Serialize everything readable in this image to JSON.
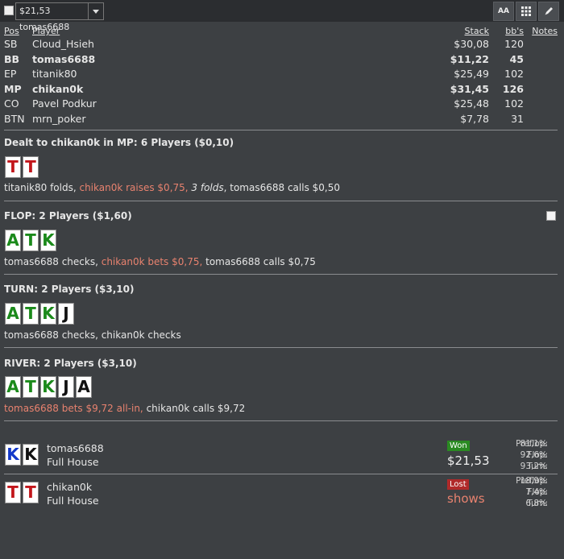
{
  "toolbar": {
    "hand_selector_value": "$21,53 tomas6688",
    "font_button_label": "AA"
  },
  "table_header": {
    "pos": "Pos",
    "player": "Player",
    "stack": "Stack",
    "bbs": "bb's",
    "notes": "Notes"
  },
  "players": [
    {
      "pos": "SB",
      "name": "Cloud_Hsieh",
      "stack": "$30,08",
      "bbs": "120",
      "bold": false
    },
    {
      "pos": "BB",
      "name": "tomas6688",
      "stack": "$11,22",
      "bbs": "45",
      "bold": true
    },
    {
      "pos": "EP",
      "name": "titanik80",
      "stack": "$25,49",
      "bbs": "102",
      "bold": false
    },
    {
      "pos": "MP",
      "name": "chikan0k",
      "stack": "$31,45",
      "bbs": "126",
      "bold": true
    },
    {
      "pos": "CO",
      "name": "Pavel Podkur",
      "stack": "$25,48",
      "bbs": "102",
      "bold": false
    },
    {
      "pos": "BTN",
      "name": "mrn_poker",
      "stack": "$7,78",
      "bbs": "31",
      "bold": false
    }
  ],
  "preflop": {
    "title": "Dealt to chikan0k in MP: 6 Players ($0,10)",
    "cards": [
      "T",
      "T"
    ],
    "action_parts": [
      "titanik80 folds, ",
      "chikan0k raises $0,75, ",
      "3 folds",
      ", tomas6688 calls $0,50"
    ]
  },
  "flop": {
    "title": "FLOP: 2 Players ($1,60)",
    "cards": [
      "A",
      "T",
      "K"
    ],
    "action_parts": [
      "tomas6688 checks, ",
      "chikan0k bets $0,75, ",
      "tomas6688 calls $0,75"
    ]
  },
  "turn": {
    "title": "TURN: 2 Players ($3,10)",
    "cards": [
      "A",
      "T",
      "K",
      "J"
    ],
    "action": "tomas6688 checks, chikan0k checks"
  },
  "river": {
    "title": "RIVER: 2 Players ($3,10)",
    "cards": [
      "A",
      "T",
      "K",
      "J",
      "A"
    ],
    "action_parts": [
      "tomas6688 bets $9,72 all-in, ",
      "chikan0k calls $9,72"
    ]
  },
  "showdown": [
    {
      "cards": [
        "K",
        "K"
      ],
      "name": "tomas6688",
      "hand": "Full House",
      "result": "Won",
      "amount": "$21,53",
      "equity": [
        {
          "street": "Preflop:",
          "value": "81,1%"
        },
        {
          "street": "Flop:",
          "value": "92,6%"
        },
        {
          "street": "Turn:",
          "value": "93,2%"
        }
      ]
    },
    {
      "cards": [
        "T",
        "T"
      ],
      "name": "chikan0k",
      "hand": "Full House",
      "result": "Lost",
      "amount": "shows",
      "equity": [
        {
          "street": "Preflop:",
          "value": "18,9%"
        },
        {
          "street": "Flop:",
          "value": "7,4%"
        },
        {
          "street": "Turn:",
          "value": "6,8%"
        }
      ]
    }
  ],
  "colors": {
    "background": "#3d4043",
    "raise_text": "#e8826f",
    "won_badge": "#2a8a22",
    "lost_badge": "#b02a2a"
  },
  "icons": [
    "grid-icon",
    "pencil-icon",
    "dropdown-arrow-icon"
  ]
}
